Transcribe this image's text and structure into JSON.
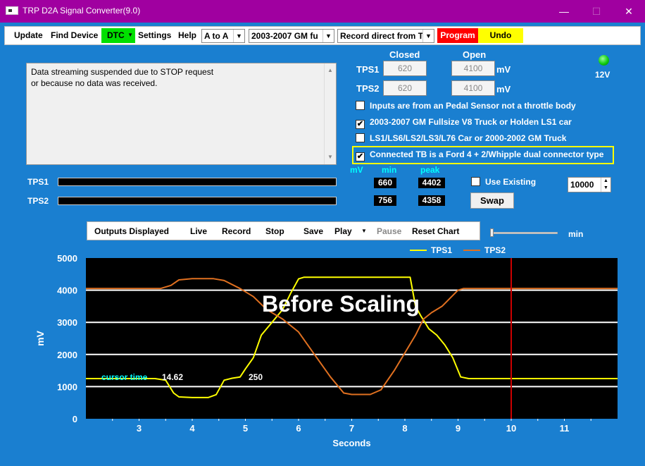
{
  "window": {
    "title": "TRP D2A Signal Converter(9.0)",
    "minimize": "—",
    "maximize": "☐",
    "close": "✕"
  },
  "menu": {
    "update": "Update",
    "find_device": "Find Device",
    "dtc": "DTC",
    "settings": "Settings",
    "help": "Help",
    "mode_select": "A to A",
    "vehicle_select": "2003-2007 GM fu",
    "record_select": "Record direct from T",
    "program": "Program",
    "undo": "Undo"
  },
  "status_message": {
    "line1": "Data streaming suspended due to STOP request",
    "line2": "or because no data was received."
  },
  "sensor": {
    "closed_label": "Closed",
    "open_label": "Open",
    "unit": "mV",
    "tps1": {
      "label": "TPS1",
      "closed": "620",
      "open": "4100"
    },
    "tps2": {
      "label": "TPS2",
      "closed": "620",
      "open": "4100"
    }
  },
  "led_label": "12V",
  "options": [
    {
      "label": "Inputs are from an Pedal Sensor not a throttle body",
      "checked": ""
    },
    {
      "label": "2003-2007 GM Fullsize V8 Truck or Holden LS1 car",
      "checked": "✔"
    },
    {
      "label": "LS1/LS6/LS2/LS3/L76 Car or 2000-2002 GM Truck",
      "checked": ""
    },
    {
      "label": "Connected TB is a Ford 4 + 2/Whipple dual connector type",
      "checked": "✔"
    }
  ],
  "readings": {
    "mv_label": "mV",
    "min_label": "min",
    "peak_label": "peak",
    "tps1": {
      "label": "TPS1",
      "min": "660",
      "peak": "4402"
    },
    "tps2": {
      "label": "TPS2",
      "min": "756",
      "peak": "4358"
    }
  },
  "use_existing": {
    "label": "Use Existing",
    "checked": ""
  },
  "spin_value": "10000",
  "swap_label": "Swap",
  "chart_toolbar": {
    "outputs": "Outputs Displayed",
    "live": "Live",
    "record": "Record",
    "stop": "Stop",
    "save": "Save",
    "play": "Play",
    "pause": "Pause",
    "reset": "Reset Chart",
    "min_label": "min"
  },
  "colors": {
    "tps1": "#ffff00",
    "tps2": "#e07020",
    "marker": "#cc0000",
    "cursor": "#00ffff"
  },
  "chart_data": {
    "type": "line",
    "title": "Before Scaling",
    "xlabel": "Seconds",
    "ylabel": "mV",
    "xlim": [
      2.0,
      12.0
    ],
    "ylim": [
      0,
      5000
    ],
    "xticks": [
      3,
      4,
      5,
      6,
      7,
      8,
      9,
      10,
      11
    ],
    "yticks": [
      0,
      1000,
      2000,
      3000,
      4000,
      5000
    ],
    "grid": "horizontal",
    "legend_position": "top-right",
    "marker_x": 10,
    "cursor_label": "cursor time",
    "cursor_value": "14.62",
    "annotation": "250",
    "series": [
      {
        "name": "TPS1",
        "x": [
          2.0,
          3.3,
          3.5,
          3.65,
          3.75,
          4.0,
          4.3,
          4.45,
          4.6,
          4.75,
          4.9,
          5.0,
          5.15,
          5.3,
          5.5,
          5.7,
          5.85,
          6.0,
          6.1,
          7.5,
          8.1,
          8.2,
          8.3,
          8.45,
          8.6,
          8.75,
          8.9,
          9.05,
          9.2,
          12.0
        ],
        "y": [
          1250,
          1250,
          1200,
          800,
          680,
          660,
          660,
          750,
          1200,
          1260,
          1300,
          1550,
          1900,
          2600,
          3000,
          3400,
          3900,
          4350,
          4402,
          4402,
          4402,
          3500,
          3200,
          2800,
          2600,
          2300,
          1900,
          1300,
          1250,
          1250
        ]
      },
      {
        "name": "TPS2",
        "x": [
          2.0,
          3.4,
          3.6,
          3.75,
          4.0,
          4.4,
          4.6,
          4.9,
          5.15,
          5.4,
          5.7,
          6.0,
          6.3,
          6.6,
          6.85,
          7.0,
          7.35,
          7.55,
          7.8,
          8.0,
          8.2,
          8.35,
          8.5,
          8.7,
          9.0,
          9.1,
          12.0
        ],
        "y": [
          4050,
          4050,
          4150,
          4320,
          4358,
          4358,
          4300,
          4050,
          3800,
          3400,
          3100,
          2700,
          2000,
          1300,
          800,
          756,
          756,
          900,
          1500,
          2050,
          2600,
          3100,
          3300,
          3500,
          4000,
          4050,
          4050
        ]
      }
    ]
  }
}
